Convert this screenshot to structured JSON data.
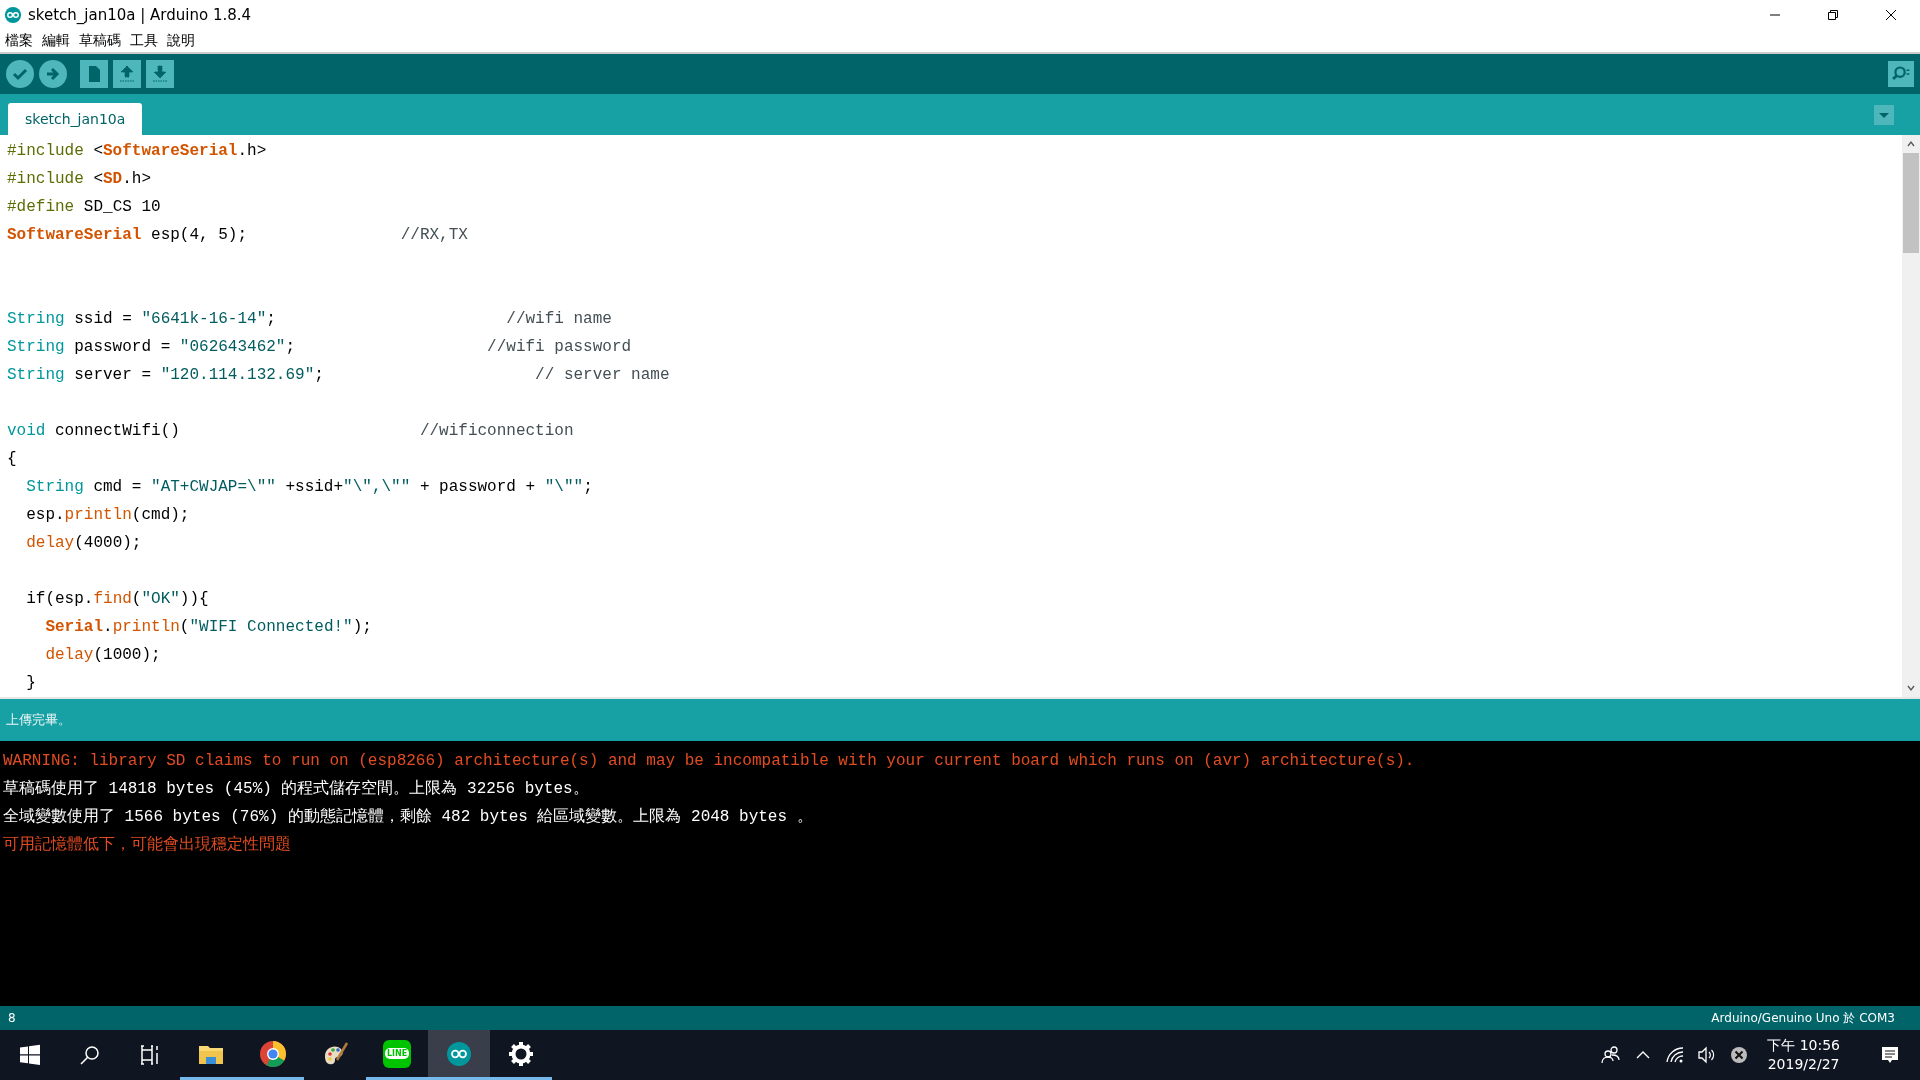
{
  "window": {
    "title": "sketch_jan10a | Arduino 1.8.4"
  },
  "menu": [
    "檔案",
    "編輯",
    "草稿碼",
    "工具",
    "說明"
  ],
  "tabs": [
    {
      "label": "sketch_jan10a",
      "selected": true
    }
  ],
  "editor": {
    "lines": [
      {
        "kind": "code",
        "tokens": [
          {
            "text": "#include",
            "kind": "preproc"
          },
          {
            "text": " <",
            "kind": "plain"
          },
          {
            "text": "SoftwareSerial",
            "kind": "class"
          },
          {
            "text": ".h>",
            "kind": "plain"
          }
        ]
      },
      {
        "kind": "code",
        "tokens": [
          {
            "text": "#include",
            "kind": "preproc"
          },
          {
            "text": " <",
            "kind": "plain"
          },
          {
            "text": "SD",
            "kind": "class"
          },
          {
            "text": ".h>",
            "kind": "plain"
          }
        ]
      },
      {
        "kind": "code",
        "tokens": [
          {
            "text": "#define",
            "kind": "preproc"
          },
          {
            "text": " SD_CS 10",
            "kind": "plain"
          }
        ]
      },
      {
        "kind": "code",
        "tokens": [
          {
            "text": "SoftwareSerial",
            "kind": "class"
          },
          {
            "text": " esp(4, 5);                ",
            "kind": "plain"
          },
          {
            "text": "//RX,TX",
            "kind": "comment"
          }
        ]
      },
      {
        "kind": "blank"
      },
      {
        "kind": "blank"
      },
      {
        "kind": "code",
        "tokens": [
          {
            "text": "String",
            "kind": "keyword"
          },
          {
            "text": " ssid = ",
            "kind": "plain"
          },
          {
            "text": "\"6641k-16-14\"",
            "kind": "string"
          },
          {
            "text": ";                        ",
            "kind": "plain"
          },
          {
            "text": "//wifi name",
            "kind": "comment"
          }
        ]
      },
      {
        "kind": "code",
        "tokens": [
          {
            "text": "String",
            "kind": "keyword"
          },
          {
            "text": " password = ",
            "kind": "plain"
          },
          {
            "text": "\"062643462\"",
            "kind": "string"
          },
          {
            "text": ";                    ",
            "kind": "plain"
          },
          {
            "text": "//wifi password",
            "kind": "comment"
          }
        ]
      },
      {
        "kind": "code",
        "tokens": [
          {
            "text": "String",
            "kind": "keyword"
          },
          {
            "text": " server = ",
            "kind": "plain"
          },
          {
            "text": "\"120.114.132.69\"",
            "kind": "string"
          },
          {
            "text": ";                      ",
            "kind": "plain"
          },
          {
            "text": "// server name",
            "kind": "comment"
          }
        ]
      },
      {
        "kind": "blank"
      },
      {
        "kind": "code",
        "tokens": [
          {
            "text": "void",
            "kind": "keyword"
          },
          {
            "text": " connectWifi()                         ",
            "kind": "plain"
          },
          {
            "text": "//wificonnection",
            "kind": "comment"
          }
        ]
      },
      {
        "kind": "code",
        "tokens": [
          {
            "text": "{",
            "kind": "plain"
          }
        ]
      },
      {
        "kind": "code",
        "tokens": [
          {
            "text": "  String",
            "kind": "keyword"
          },
          {
            "text": " cmd = ",
            "kind": "plain"
          },
          {
            "text": "\"AT+CWJAP=\\\"\"",
            "kind": "string"
          },
          {
            "text": " +ssid+",
            "kind": "plain"
          },
          {
            "text": "\"\\\",\\\"\"",
            "kind": "string"
          },
          {
            "text": " + password + ",
            "kind": "plain"
          },
          {
            "text": "\"\\\"\"",
            "kind": "string"
          },
          {
            "text": ";",
            "kind": "plain"
          }
        ]
      },
      {
        "kind": "code",
        "tokens": [
          {
            "text": "  esp.",
            "kind": "plain"
          },
          {
            "text": "println",
            "kind": "func"
          },
          {
            "text": "(cmd);",
            "kind": "plain"
          }
        ]
      },
      {
        "kind": "code",
        "tokens": [
          {
            "text": "  delay",
            "kind": "func"
          },
          {
            "text": "(4000);",
            "kind": "plain"
          }
        ]
      },
      {
        "kind": "blank"
      },
      {
        "kind": "code",
        "tokens": [
          {
            "text": "  if(esp.",
            "kind": "plain"
          },
          {
            "text": "find",
            "kind": "func"
          },
          {
            "text": "(",
            "kind": "plain"
          },
          {
            "text": "\"OK\"",
            "kind": "string"
          },
          {
            "text": ")){",
            "kind": "plain"
          }
        ]
      },
      {
        "kind": "code",
        "tokens": [
          {
            "text": "    Serial",
            "kind": "class"
          },
          {
            "text": ".",
            "kind": "plain"
          },
          {
            "text": "println",
            "kind": "func"
          },
          {
            "text": "(",
            "kind": "plain"
          },
          {
            "text": "\"WIFI Connected!\"",
            "kind": "string"
          },
          {
            "text": ");",
            "kind": "plain"
          }
        ]
      },
      {
        "kind": "code",
        "tokens": [
          {
            "text": "    delay",
            "kind": "func"
          },
          {
            "text": "(1000);",
            "kind": "plain"
          }
        ]
      },
      {
        "kind": "code",
        "tokens": [
          {
            "text": "  }",
            "kind": "plain"
          }
        ]
      }
    ]
  },
  "status_message": "上傳完畢。",
  "console": {
    "lines": [
      {
        "kind": "warning",
        "text": "WARNING: library SD claims to run on (esp8266) architecture(s) and may be incompatible with your current board which runs on (avr) architecture(s)."
      },
      {
        "kind": "info",
        "text": "草稿碼使用了 14818 bytes (45%) 的程式儲存空間。上限為 32256 bytes。"
      },
      {
        "kind": "info",
        "text": "全域變數使用了 1566 bytes (76%) 的動態記憶體，剩餘 482 bytes 給區域變數。上限為 2048 bytes 。"
      },
      {
        "kind": "error",
        "text": "可用記憶體低下，可能會出現穩定性問題"
      }
    ]
  },
  "status_bar": {
    "line": "8",
    "board": "Arduino/Genuino Uno 於 COM3"
  },
  "taskbar": {
    "apps": [
      {
        "kind": "explorer",
        "running": true,
        "active": false
      },
      {
        "kind": "browser",
        "running": true,
        "active": false
      },
      {
        "kind": "paint",
        "running": false,
        "active": false
      },
      {
        "kind": "line",
        "label": "LINE",
        "running": true,
        "active": false
      },
      {
        "kind": "arduino",
        "running": true,
        "active": true
      },
      {
        "kind": "settings",
        "running": true,
        "active": false
      }
    ],
    "clock": {
      "time": "下午 10:56",
      "date": "2019/2/27"
    }
  }
}
